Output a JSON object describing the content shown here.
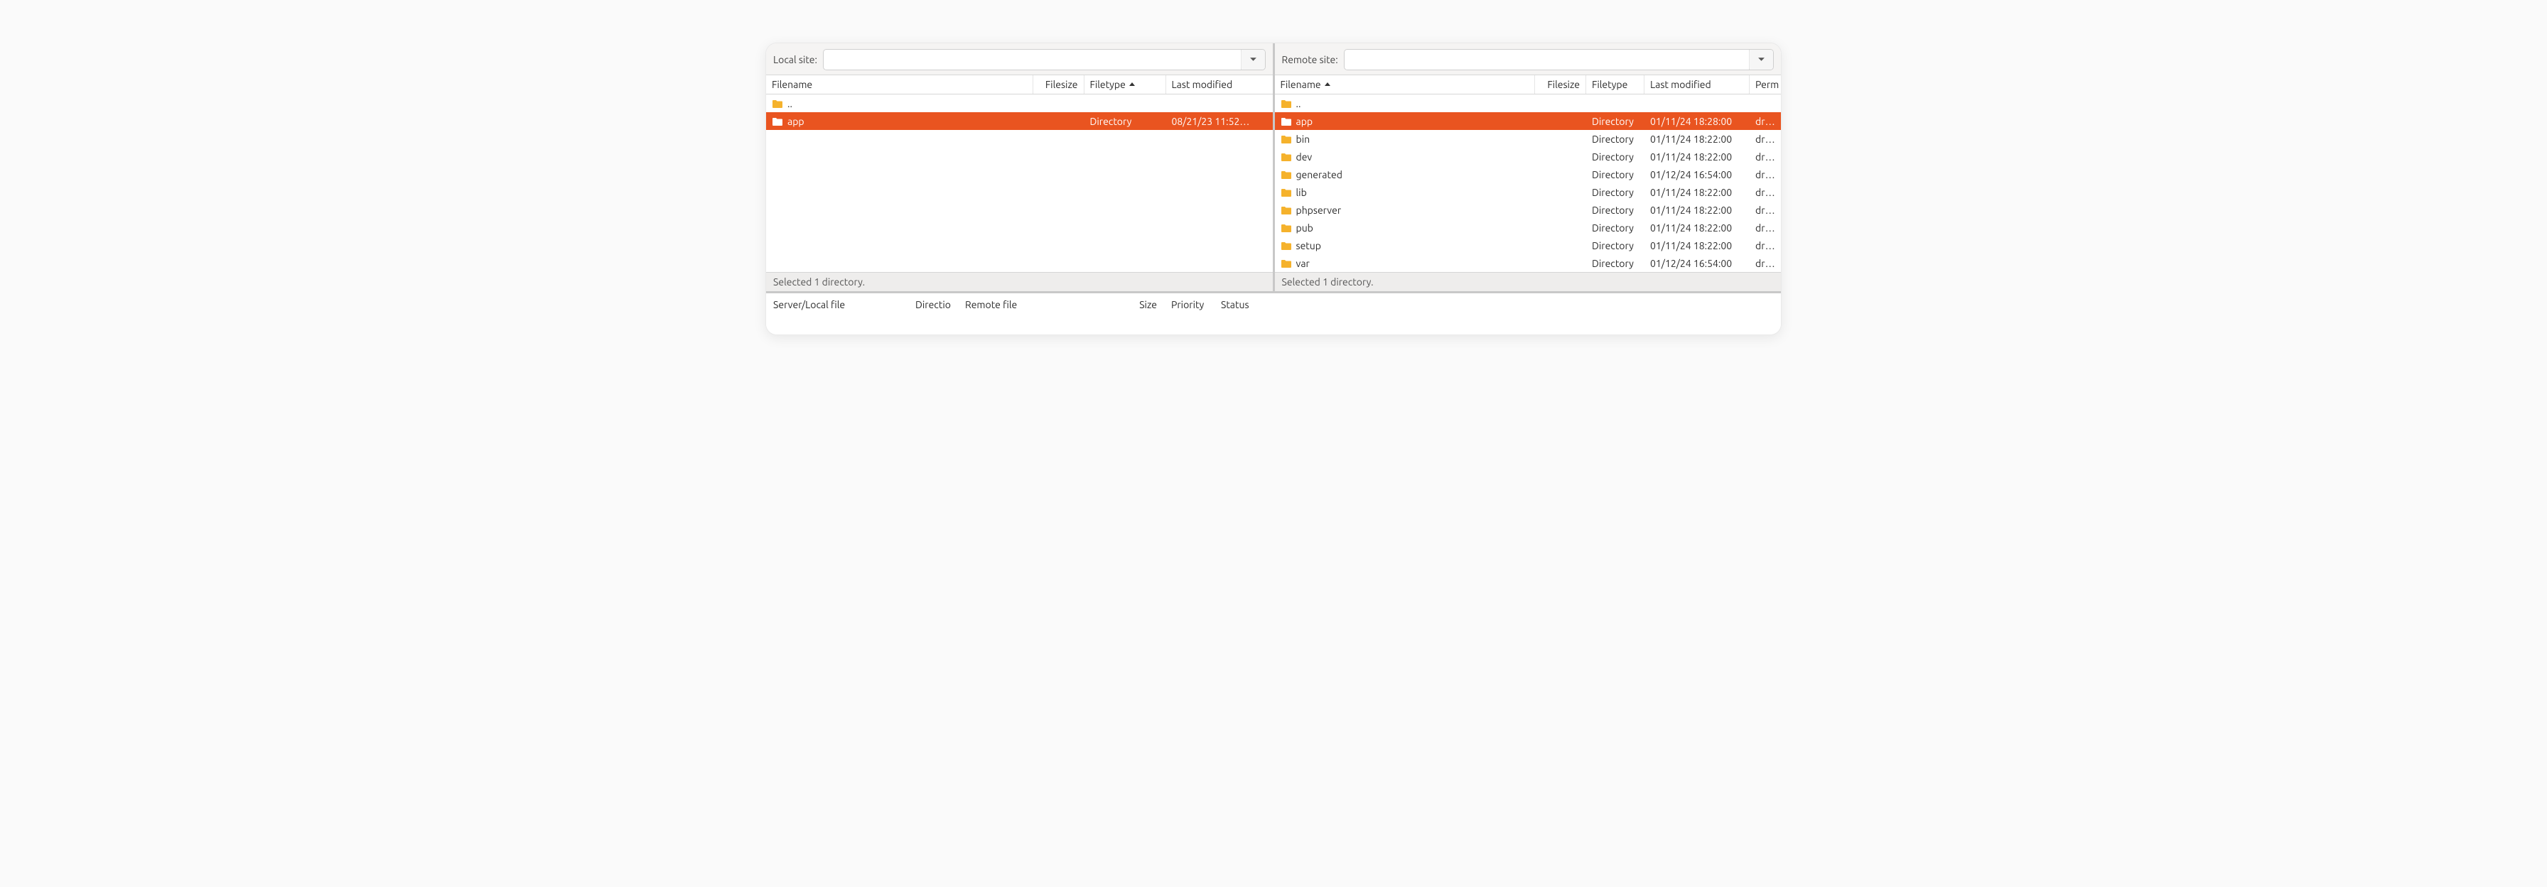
{
  "local": {
    "site_label": "Local site:",
    "columns": {
      "name": "Filename",
      "size": "Filesize",
      "type": "Filetype",
      "modified": "Last modified"
    },
    "sorted_col": "type",
    "rows": [
      {
        "name": "..",
        "type": "",
        "modified": "",
        "selected": false,
        "isUp": true
      },
      {
        "name": "app",
        "type": "Directory",
        "modified": "08/21/23 11:52…",
        "selected": true
      }
    ],
    "status": "Selected 1 directory."
  },
  "remote": {
    "site_label": "Remote site:",
    "columns": {
      "name": "Filename",
      "size": "Filesize",
      "type": "Filetype",
      "modified": "Last modified",
      "perm": "Perm"
    },
    "sorted_col": "name",
    "rows": [
      {
        "name": "..",
        "type": "",
        "modified": "",
        "perm": "",
        "selected": false,
        "isUp": true
      },
      {
        "name": "app",
        "type": "Directory",
        "modified": "01/11/24 18:28:00",
        "perm": "drwx",
        "selected": true
      },
      {
        "name": "bin",
        "type": "Directory",
        "modified": "01/11/24 18:22:00",
        "perm": "drwx",
        "selected": false
      },
      {
        "name": "dev",
        "type": "Directory",
        "modified": "01/11/24 18:22:00",
        "perm": "drwx",
        "selected": false
      },
      {
        "name": "generated",
        "type": "Directory",
        "modified": "01/12/24 16:54:00",
        "perm": "drwx",
        "selected": false
      },
      {
        "name": "lib",
        "type": "Directory",
        "modified": "01/11/24 18:22:00",
        "perm": "drwx",
        "selected": false
      },
      {
        "name": "phpserver",
        "type": "Directory",
        "modified": "01/11/24 18:22:00",
        "perm": "drwx",
        "selected": false
      },
      {
        "name": "pub",
        "type": "Directory",
        "modified": "01/11/24 18:22:00",
        "perm": "drwx",
        "selected": false
      },
      {
        "name": "setup",
        "type": "Directory",
        "modified": "01/11/24 18:22:00",
        "perm": "drwx",
        "selected": false
      },
      {
        "name": "var",
        "type": "Directory",
        "modified": "01/12/24 16:54:00",
        "perm": "drwx",
        "selected": false
      }
    ],
    "status": "Selected 1 directory."
  },
  "queue": {
    "columns": {
      "file": "Server/Local file",
      "dir": "Directio",
      "remote": "Remote file",
      "size": "Size",
      "priority": "Priority",
      "status": "Status"
    }
  }
}
